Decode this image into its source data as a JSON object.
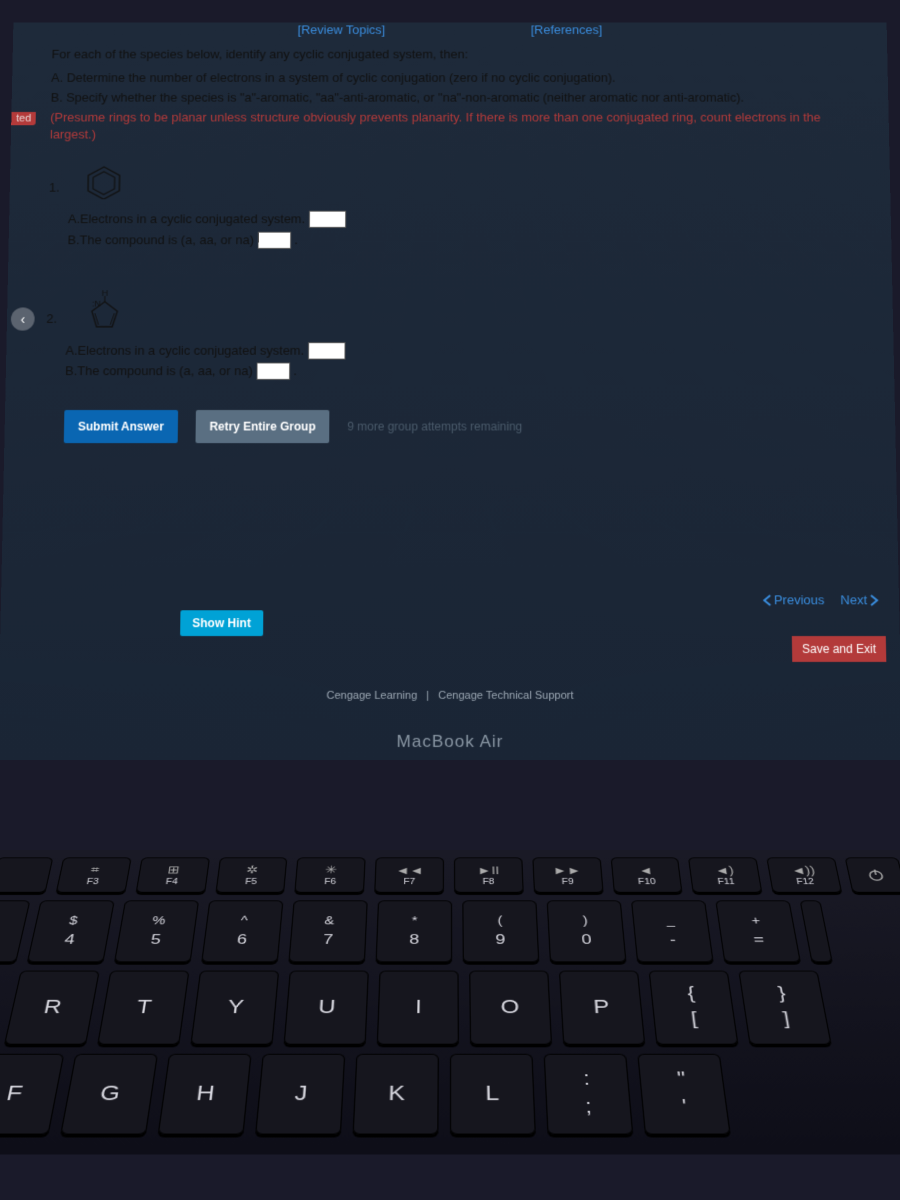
{
  "tabs": {
    "review": "[Review Topics]",
    "references": "[References]"
  },
  "side_tag": "ted",
  "intro": "For each of the species below, identify any cyclic conjugated system, then:",
  "instr": {
    "a": "A. Determine the number of electrons in a system of cyclic conjugation (zero if no cyclic conjugation).",
    "b": "B. Specify whether the species is \"a\"-aromatic, \"aa\"-anti-aromatic, or \"na\"-non-aromatic (neither aromatic nor anti-aromatic).",
    "c": "(Presume rings to be planar unless structure obviously prevents planarity. If there is more than one conjugated ring, count electrons in the largest.)"
  },
  "q1": {
    "num": "1.",
    "a": "A.Electrons in a cyclic conjugated system.",
    "b": "B.The compound is (a, aa, or na)"
  },
  "q2": {
    "num": "2.",
    "label_h": "H",
    "label_n": ":N",
    "a": "A.Electrons in a cyclic conjugated system.",
    "b": "B.The compound is (a, aa, or na)"
  },
  "buttons": {
    "submit": "Submit Answer",
    "retry": "Retry Entire Group",
    "attempts": "9 more group attempts remaining",
    "showhint": "Show Hint",
    "previous": "Previous",
    "next": "Next",
    "saveexit": "Save and Exit"
  },
  "footer": {
    "a": "Cengage Learning",
    "sep": "|",
    "b": "Cengage Technical Support"
  },
  "mba": "MacBook Air",
  "keyboard": {
    "fkeys": [
      {
        "icon": "⌗",
        "label": "F3"
      },
      {
        "icon": "⊞",
        "label": "F4"
      },
      {
        "icon": "✲",
        "label": "F5"
      },
      {
        "icon": "✳",
        "label": "F6"
      },
      {
        "icon": "◄◄",
        "label": "F7"
      },
      {
        "icon": "►II",
        "label": "F8"
      },
      {
        "icon": "►►",
        "label": "F9"
      },
      {
        "icon": "◄",
        "label": "F10"
      },
      {
        "icon": "◄)",
        "label": "F11"
      },
      {
        "icon": "◄))",
        "label": "F12"
      }
    ],
    "power": "⏻",
    "numrow": [
      {
        "top": "$",
        "bot": "4"
      },
      {
        "top": "%",
        "bot": "5"
      },
      {
        "top": "^",
        "bot": "6"
      },
      {
        "top": "&",
        "bot": "7"
      },
      {
        "top": "*",
        "bot": "8"
      },
      {
        "top": "(",
        "bot": "9"
      },
      {
        "top": ")",
        "bot": "0"
      },
      {
        "top": "_",
        "bot": "-"
      },
      {
        "top": "+",
        "bot": "="
      }
    ],
    "row2": [
      "R",
      "T",
      "Y",
      "U",
      "I",
      "O",
      "P"
    ],
    "row2_br": [
      {
        "top": "{",
        "bot": "["
      },
      {
        "top": "}",
        "bot": "]"
      }
    ],
    "row3": [
      "F",
      "G",
      "H",
      "J",
      "K",
      "L"
    ],
    "row3_br": [
      {
        "top": ":",
        "bot": ";"
      },
      {
        "top": "\"",
        "bot": "'"
      }
    ]
  }
}
